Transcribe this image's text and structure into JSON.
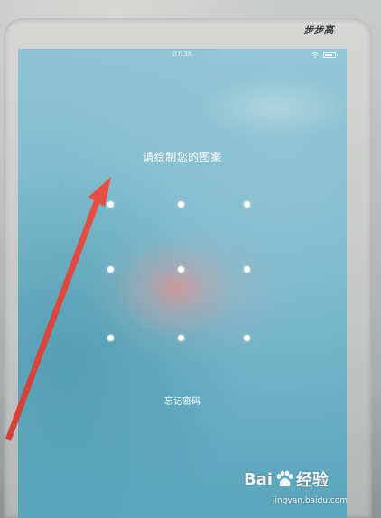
{
  "device": {
    "brand_logo_text": "步步高"
  },
  "status_bar": {
    "time": "07:36",
    "wifi_icon": "wifi-icon",
    "battery_icon": "battery-icon",
    "battery_level": 0.75
  },
  "lock_screen": {
    "prompt": "请绘制您的图案",
    "pattern_dots": 9,
    "forgot_password_label": "忘记密码"
  },
  "annotation": {
    "arrow_color": "#e8443a",
    "arrow_icon": "red-arrow-annotation"
  },
  "watermark": {
    "brand_prefix": "Bai",
    "brand_suffix": "经验",
    "url": "jingyan.baidu.com"
  },
  "colors": {
    "screen_top": "#8fc4d2",
    "screen_bottom": "#5ba6bd",
    "text": "#ffffff"
  }
}
